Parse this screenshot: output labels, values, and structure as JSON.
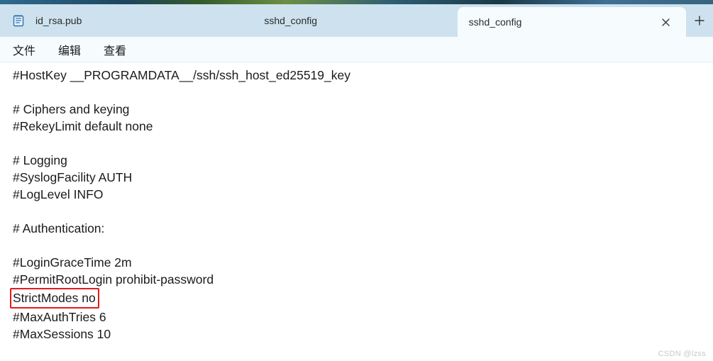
{
  "tabs": [
    {
      "label": "id_rsa.pub",
      "active": false,
      "hasIcon": true
    },
    {
      "label": "sshd_config",
      "active": false,
      "hasIcon": false
    },
    {
      "label": "sshd_config",
      "active": true,
      "hasIcon": false
    }
  ],
  "menu": {
    "file": "文件",
    "edit": "编辑",
    "view": "查看"
  },
  "content": {
    "lines": [
      "#HostKey __PROGRAMDATA__/ssh/ssh_host_ed25519_key",
      "",
      "# Ciphers and keying",
      "#RekeyLimit default none",
      "",
      "# Logging",
      "#SyslogFacility AUTH",
      "#LogLevel INFO",
      "",
      "# Authentication:",
      "",
      "#LoginGraceTime 2m",
      "#PermitRootLogin prohibit-password",
      "StrictModes no",
      "#MaxAuthTries 6",
      "#MaxSessions 10"
    ],
    "highlightIndex": 13
  },
  "watermark": "CSDN @lzss"
}
